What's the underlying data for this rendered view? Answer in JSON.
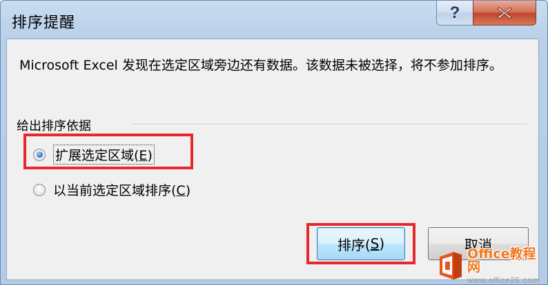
{
  "window": {
    "title": "排序提醒",
    "help_label": "?",
    "close_icon": "close-icon"
  },
  "message": {
    "text": "Microsoft Excel 发现在选定区域旁边还有数据。该数据未被选择，将不参加排序。"
  },
  "sort_basis": {
    "label": "给出排序依据",
    "options": [
      {
        "label": "扩展选定区域(",
        "hotkey": "E",
        "suffix": ")",
        "checked": true
      },
      {
        "label": "以当前选定区域排序(",
        "hotkey": "C",
        "suffix": ")",
        "checked": false
      }
    ]
  },
  "buttons": {
    "sort": {
      "label": "排序(",
      "hotkey": "S",
      "suffix": ")"
    },
    "cancel": {
      "label": "取消"
    }
  },
  "watermark": {
    "name": "Office教程网",
    "url": "www.office26.com"
  },
  "colors": {
    "highlight": "#e8262b",
    "accent": "#1b6fc9",
    "brand_orange": "#f0781e"
  }
}
